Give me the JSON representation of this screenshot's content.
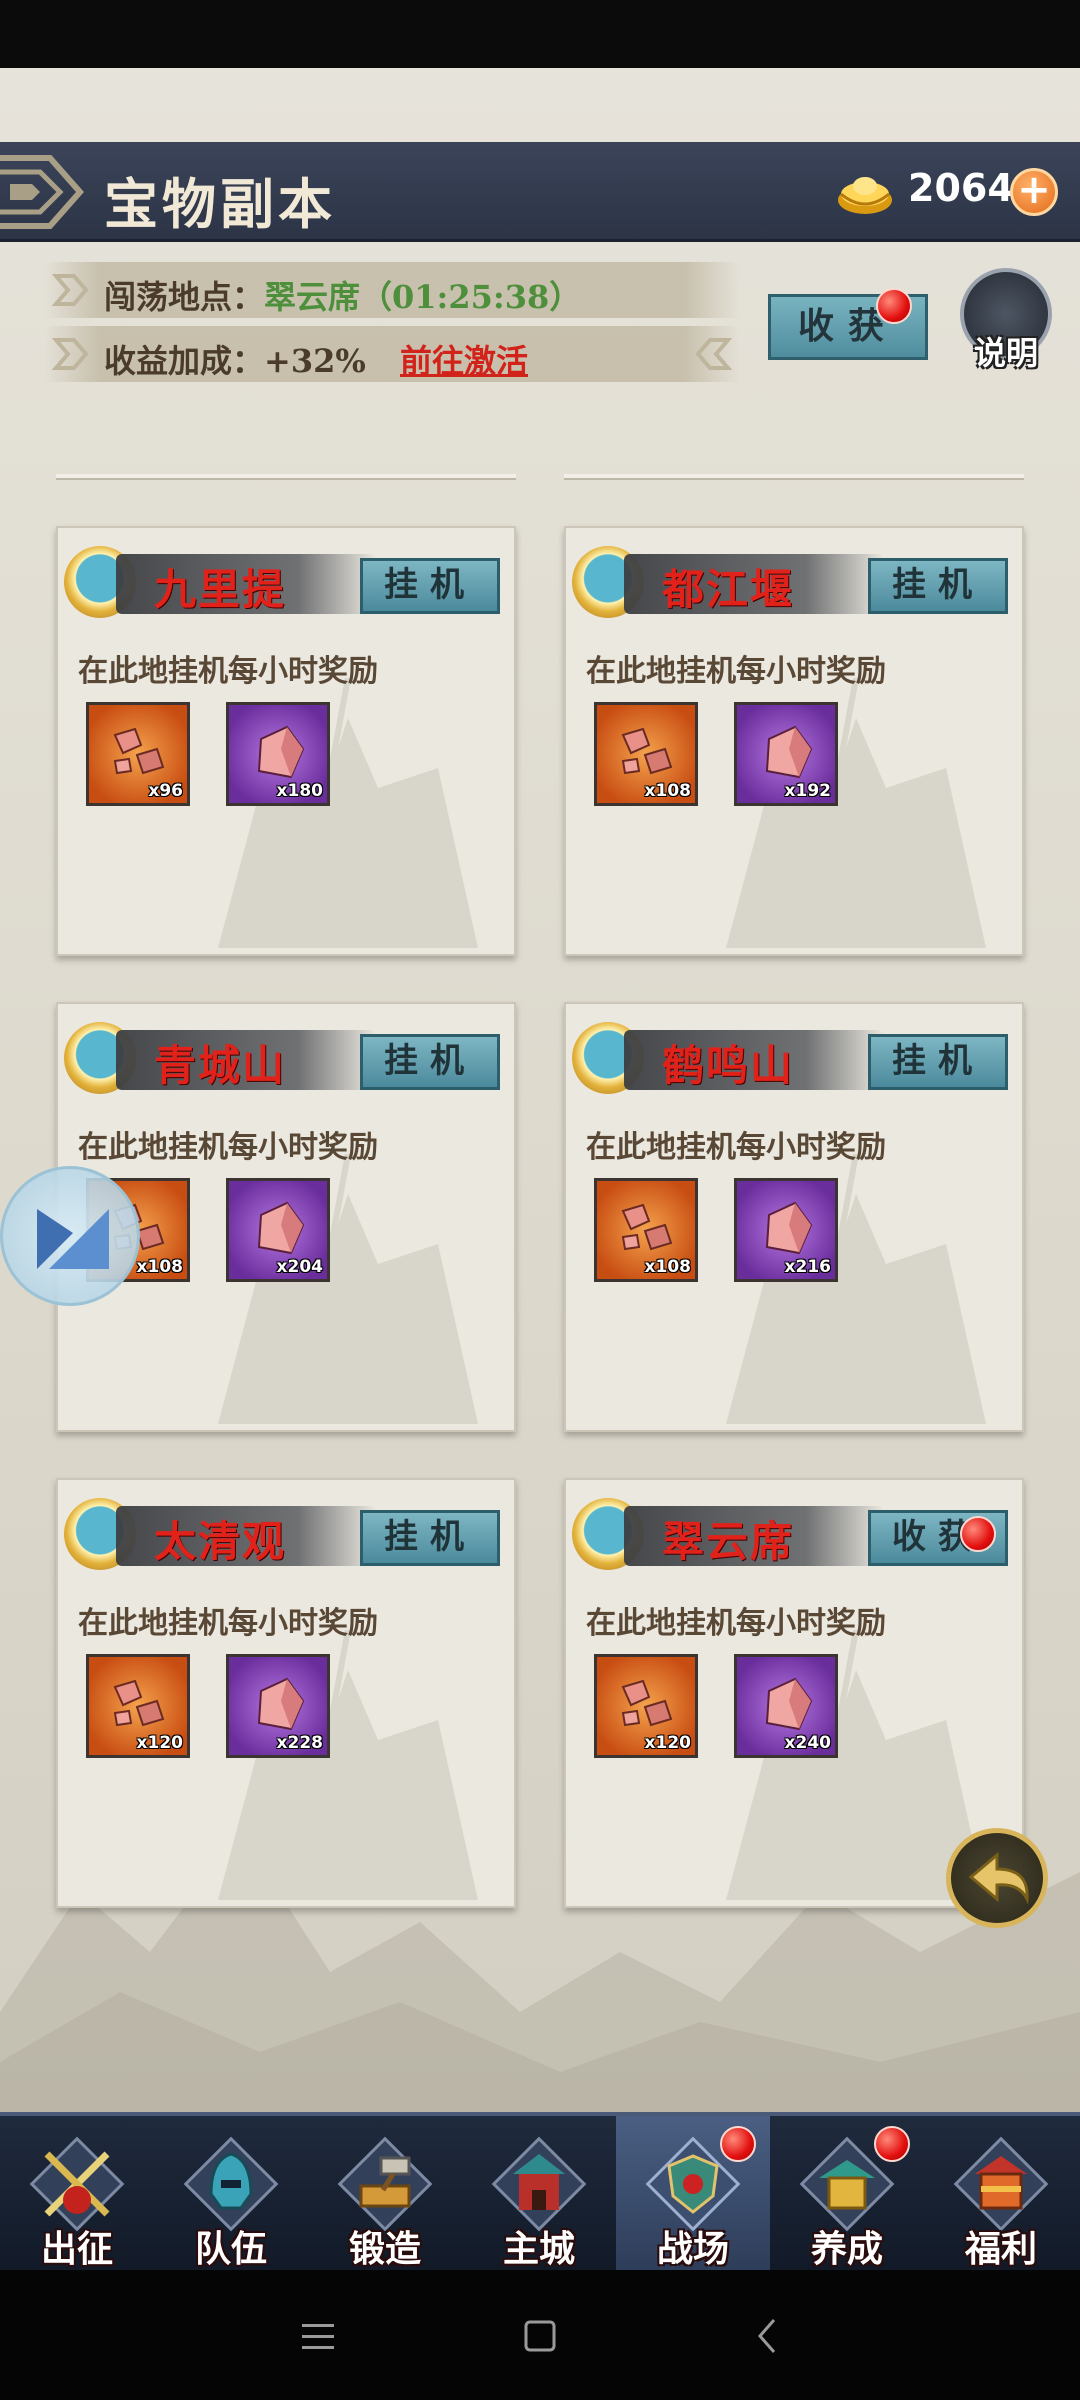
{
  "header": {
    "title": "宝物副本",
    "gold_amount": "20640",
    "gold_plus": "+"
  },
  "info": {
    "location_label": "闯荡地点：",
    "location_value": "翠云席（01:25:38）",
    "bonus_text": "收益加成：+32%",
    "activate_link": "前往激活"
  },
  "collect_button": "收获",
  "help_label": "说明",
  "card_description": "在此地挂机每小时奖励",
  "cards": [
    {
      "name": "九里提",
      "button": "挂机",
      "reward1": "x96",
      "reward2": "x180"
    },
    {
      "name": "都江堰",
      "button": "挂机",
      "reward1": "x108",
      "reward2": "x192"
    },
    {
      "name": "青城山",
      "button": "挂机",
      "reward1": "x108",
      "reward2": "x204"
    },
    {
      "name": "鹤鸣山",
      "button": "挂机",
      "reward1": "x108",
      "reward2": "x216"
    },
    {
      "name": "太清观",
      "button": "挂机",
      "reward1": "x120",
      "reward2": "x228"
    },
    {
      "name": "翠云席",
      "button": "收获",
      "reward1": "x120",
      "reward2": "x240"
    }
  ],
  "nav": [
    {
      "label": "出征",
      "icon": "crossed-swords-icon"
    },
    {
      "label": "队伍",
      "icon": "hero-helmet-icon"
    },
    {
      "label": "锻造",
      "icon": "anvil-hammer-icon"
    },
    {
      "label": "主城",
      "icon": "castle-gate-icon"
    },
    {
      "label": "战场",
      "icon": "battle-shield-icon"
    },
    {
      "label": "养成",
      "icon": "pagoda-icon"
    },
    {
      "label": "福利",
      "icon": "gift-temple-icon"
    }
  ],
  "colors": {
    "header_bg": "#2c3446",
    "card_title_red": "#e0221b",
    "button_teal": "#5f9fae",
    "notification_red": "#e20f0f"
  }
}
